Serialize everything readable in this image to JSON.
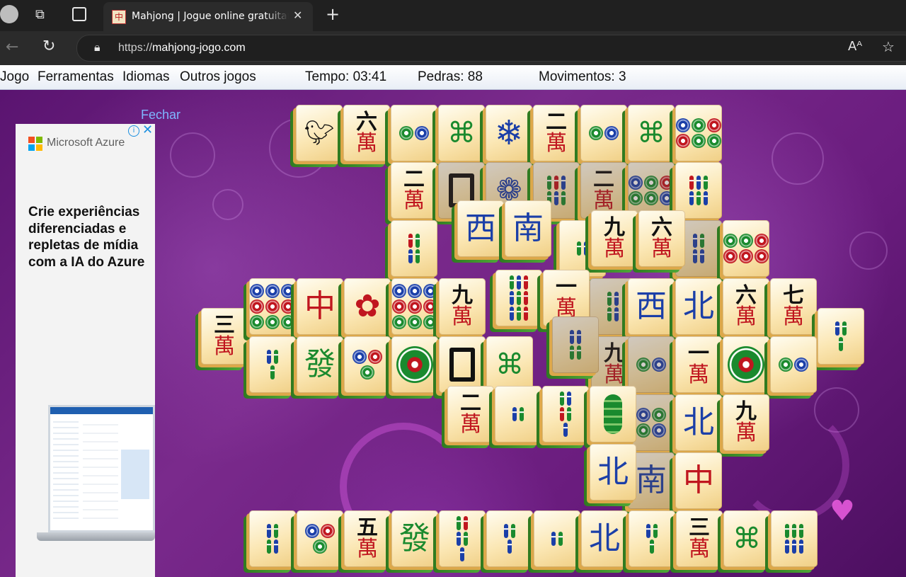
{
  "browser": {
    "tab_title": "Mahjong | Jogue online gratuitamente",
    "tab_favicon_char": "中",
    "url_prefix": "https://",
    "url_host": "mahjong-jogo.com"
  },
  "menu": {
    "items": [
      "Jogo",
      "Ferramentas",
      "Idiomas",
      "Outros jogos"
    ],
    "time": "Tempo: 03:41",
    "stones": "Pedras: 88",
    "moves": "Movimentos: 3"
  },
  "ad": {
    "close_label": "Fechar",
    "brand": "Microsoft Azure",
    "headline": "Crie experiências diferenciadas e repletas de mídia com a IA do Azure",
    "logo_colors": [
      "#f25022",
      "#7fba00",
      "#00a4ef",
      "#ffb900"
    ]
  },
  "tiles": [
    {
      "id": "r1c1",
      "kind": "bird",
      "label": "bird"
    },
    {
      "id": "r1c2",
      "kind": "char",
      "num": "六",
      "man": "萬"
    },
    {
      "id": "r1c3",
      "kind": "dots",
      "pattern": [
        "g",
        "b"
      ]
    },
    {
      "id": "r1c4",
      "kind": "season",
      "label": "bamboo-knot"
    },
    {
      "id": "r1c5",
      "kind": "snow",
      "label": "snowflake"
    },
    {
      "id": "r1c6",
      "kind": "char",
      "num": "二",
      "man": "萬"
    },
    {
      "id": "r1c7",
      "kind": "dots",
      "pattern": [
        "g",
        "b"
      ]
    },
    {
      "id": "r1c8",
      "kind": "season",
      "label": "bamboo-knot"
    },
    {
      "id": "r1c9",
      "kind": "dots",
      "pattern": [
        "b",
        "g",
        "r",
        "r",
        "g",
        "g"
      ]
    },
    {
      "id": "r2c1",
      "kind": "char",
      "num": "二",
      "man": "萬"
    },
    {
      "id": "r2c2",
      "kind": "frame"
    },
    {
      "id": "r2c3",
      "kind": "flower",
      "label": "flower"
    },
    {
      "id": "r2c4",
      "kind": "sticks",
      "pattern": [
        "g",
        "r",
        "b",
        "g",
        "b",
        "g"
      ]
    },
    {
      "id": "r2c5",
      "kind": "char",
      "num": "二",
      "man": "萬"
    },
    {
      "id": "r2c6",
      "kind": "dots",
      "pattern": [
        "b",
        "g",
        "r",
        "g",
        "g",
        "b"
      ]
    },
    {
      "id": "r2c7",
      "kind": "sticks",
      "pattern": [
        "r",
        "b",
        "g",
        "b",
        "g",
        "b"
      ]
    },
    {
      "id": "r3c1",
      "kind": "sticks",
      "pattern": [
        "r",
        "g",
        "b",
        "g"
      ]
    },
    {
      "id": "r3c2",
      "kind": "wind",
      "char": "西",
      "color": "blue"
    },
    {
      "id": "r3c3",
      "kind": "wind",
      "char": "南",
      "color": "blue"
    },
    {
      "id": "r3c4",
      "kind": "sticks",
      "pattern": [
        "g",
        "b"
      ]
    },
    {
      "id": "r3c5",
      "kind": "char",
      "num": "九",
      "man": "萬"
    },
    {
      "id": "r3c6",
      "kind": "char",
      "num": "六",
      "man": "萬"
    },
    {
      "id": "r3c7",
      "kind": "sticks",
      "pattern": [
        "b",
        "g",
        "b",
        "b"
      ]
    },
    {
      "id": "r3c8",
      "kind": "dots",
      "pattern": [
        "g",
        "g",
        "r",
        "r",
        "r",
        "r"
      ]
    },
    {
      "id": "r4c0",
      "kind": "char",
      "num": "三",
      "man": "萬"
    },
    {
      "id": "r4c1",
      "kind": "dots",
      "pattern": [
        "b",
        "b",
        "b",
        "r",
        "r",
        "r",
        "g",
        "g",
        "g"
      ]
    },
    {
      "id": "r4c2",
      "kind": "dragon",
      "char": "中",
      "color": "red"
    },
    {
      "id": "r4c3",
      "kind": "flower",
      "label": "hibiscus"
    },
    {
      "id": "r4c4",
      "kind": "dots",
      "pattern": [
        "b",
        "b",
        "b",
        "r",
        "r",
        "r",
        "g",
        "g",
        "g"
      ]
    },
    {
      "id": "r4c5",
      "kind": "char",
      "num": "九",
      "man": "萬"
    },
    {
      "id": "r4c6",
      "kind": "sticks",
      "pattern": [
        "g",
        "b",
        "r",
        "b",
        "g",
        "r",
        "b",
        "g",
        "r"
      ]
    },
    {
      "id": "r4c7",
      "kind": "char",
      "num": "一",
      "man": "萬"
    },
    {
      "id": "r4c8",
      "kind": "sticks",
      "pattern": [
        "g",
        "b",
        "g",
        "b"
      ]
    },
    {
      "id": "r4c9",
      "kind": "wind",
      "char": "西",
      "color": "blue"
    },
    {
      "id": "r4c10",
      "kind": "wind",
      "char": "北",
      "color": "blue"
    },
    {
      "id": "r4c11",
      "kind": "char",
      "num": "六",
      "man": "萬"
    },
    {
      "id": "r4c12",
      "kind": "char",
      "num": "七",
      "man": "萬"
    },
    {
      "id": "r4c13",
      "kind": "sticks",
      "pattern": [
        "b",
        "g",
        "g"
      ]
    },
    {
      "id": "r5c1",
      "kind": "sticks",
      "pattern": [
        "b",
        "g",
        "g"
      ]
    },
    {
      "id": "r5c2",
      "kind": "dragon",
      "char": "發",
      "color": "green"
    },
    {
      "id": "r5c3",
      "kind": "dots",
      "pattern": [
        "b",
        "r",
        "g"
      ]
    },
    {
      "id": "r5c4",
      "kind": "bigdot"
    },
    {
      "id": "r5c5",
      "kind": "frame"
    },
    {
      "id": "r5c6",
      "kind": "season",
      "label": "bamboo-knot"
    },
    {
      "id": "r5c7",
      "kind": "sticks",
      "pattern": [
        "b",
        "b",
        "g",
        "g"
      ]
    },
    {
      "id": "r5c8",
      "kind": "char",
      "num": "九",
      "man": "萬"
    },
    {
      "id": "r5c9",
      "kind": "dots",
      "pattern": [
        "g",
        "b"
      ]
    },
    {
      "id": "r5c10",
      "kind": "char",
      "num": "一",
      "man": "萬"
    },
    {
      "id": "r5c11",
      "kind": "bigdot"
    },
    {
      "id": "r5c12",
      "kind": "dots",
      "pattern": [
        "g",
        "b"
      ]
    },
    {
      "id": "r6c1",
      "kind": "char",
      "num": "二",
      "man": "萬"
    },
    {
      "id": "r6c2",
      "kind": "sticks",
      "pattern": [
        "b",
        "g"
      ]
    },
    {
      "id": "r6c3",
      "kind": "sticks",
      "pattern": [
        "g",
        "b",
        "r",
        "g",
        "b"
      ]
    },
    {
      "id": "r6c4",
      "kind": "bamboo",
      "label": "bamboo"
    },
    {
      "id": "r6c5",
      "kind": "dots",
      "pattern": [
        "b",
        "g",
        "g",
        "b"
      ]
    },
    {
      "id": "r6c6",
      "kind": "wind",
      "char": "北",
      "color": "blue"
    },
    {
      "id": "r6c7",
      "kind": "char",
      "num": "九",
      "man": "萬"
    },
    {
      "id": "r7c1",
      "kind": "wind",
      "char": "北",
      "color": "blue"
    },
    {
      "id": "r7c2",
      "kind": "wind",
      "char": "南",
      "color": "blue"
    },
    {
      "id": "r7c3",
      "kind": "dragon",
      "char": "中",
      "color": "red"
    },
    {
      "id": "r8c1",
      "kind": "sticks",
      "pattern": [
        "b",
        "g",
        "g",
        "b"
      ]
    },
    {
      "id": "r8c2",
      "kind": "dots",
      "pattern": [
        "b",
        "r",
        "g"
      ]
    },
    {
      "id": "r8c3",
      "kind": "char",
      "num": "五",
      "man": "萬"
    },
    {
      "id": "r8c4",
      "kind": "dragon",
      "char": "發",
      "color": "green"
    },
    {
      "id": "r8c5",
      "kind": "sticks",
      "pattern": [
        "g",
        "r",
        "b",
        "g",
        "b"
      ]
    },
    {
      "id": "r8c6",
      "kind": "sticks",
      "pattern": [
        "b",
        "g",
        "b"
      ]
    },
    {
      "id": "r8c7",
      "kind": "sticks",
      "pattern": [
        "b",
        "g"
      ]
    },
    {
      "id": "r8c8",
      "kind": "wind",
      "char": "北",
      "color": "blue"
    },
    {
      "id": "r8c9",
      "kind": "sticks",
      "pattern": [
        "b",
        "g",
        "g"
      ]
    },
    {
      "id": "r8c10",
      "kind": "char",
      "num": "三",
      "man": "萬"
    },
    {
      "id": "r8c11",
      "kind": "season",
      "label": "bamboo-knot"
    },
    {
      "id": "r8c12",
      "kind": "sticks",
      "pattern": [
        "g",
        "g",
        "g",
        "b",
        "b",
        "b"
      ]
    }
  ]
}
